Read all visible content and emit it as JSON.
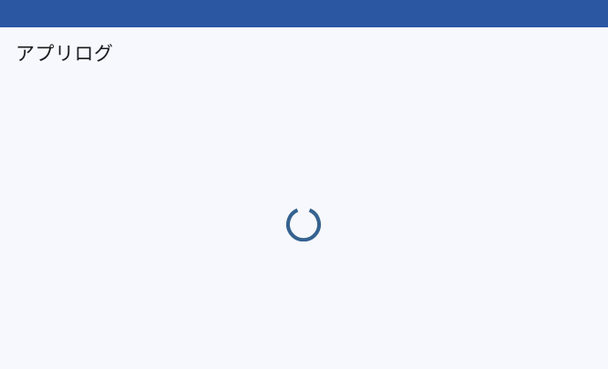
{
  "app_bar": {
    "color": "#2a56a2"
  },
  "page": {
    "title": "アプリログ",
    "background": "#f6f8fd"
  },
  "loading": {
    "indicator": "spinner-icon",
    "color": "#35628f"
  }
}
